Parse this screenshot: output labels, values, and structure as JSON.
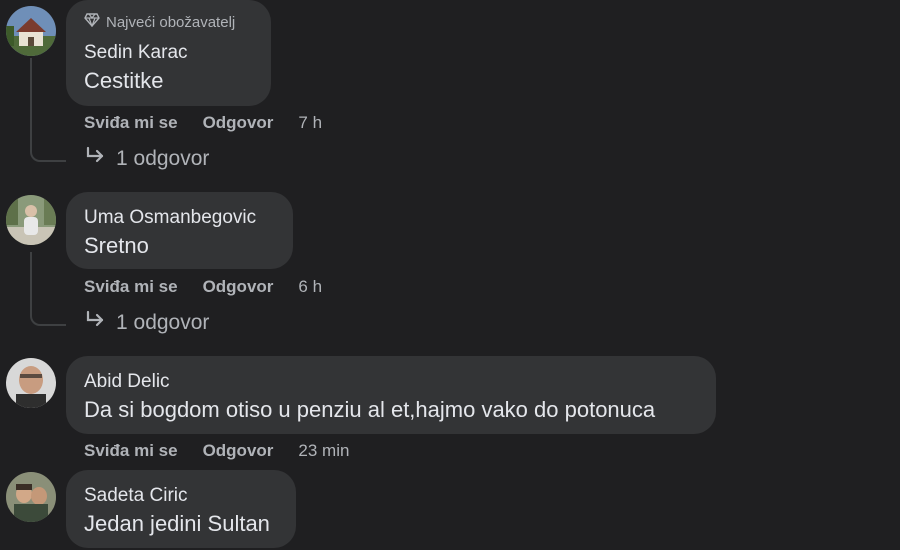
{
  "comments": [
    {
      "badge": "Najveći obožavatelj",
      "badge_icon": "diamond-icon",
      "author": "Sedin Karac",
      "text": "Cestitke",
      "like_label": "Sviđa mi se",
      "reply_label": "Odgovor",
      "time": "7 h",
      "replies_label": "1 odgovor"
    },
    {
      "author": "Uma Osmanbegovic",
      "text": "Sretno",
      "like_label": "Sviđa mi se",
      "reply_label": "Odgovor",
      "time": "6 h",
      "replies_label": "1 odgovor"
    },
    {
      "author": "Abid Delic",
      "text": "Da si bogdom otiso u penziu al et,hajmo vako do potonuca",
      "like_label": "Sviđa mi se",
      "reply_label": "Odgovor",
      "time": "23 min"
    },
    {
      "author": "Sadeta Ciric",
      "text": "Jedan jedini Sultan"
    }
  ],
  "colors": {
    "background": "#1f1f21",
    "bubble": "#333436",
    "primary_text": "#e4e6eb",
    "secondary_text": "#b0b3b8"
  }
}
